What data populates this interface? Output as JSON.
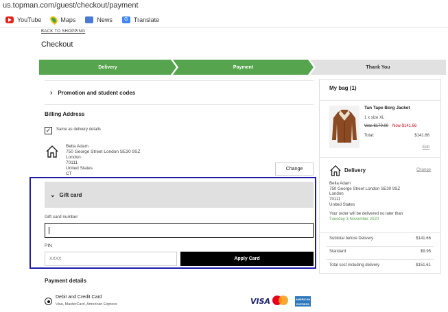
{
  "browser": {
    "url": "us.topman.com/guest/checkout/payment",
    "bookmarks": [
      {
        "label": "YouTube",
        "icon": "youtube-icon"
      },
      {
        "label": "Maps",
        "icon": "maps-icon"
      },
      {
        "label": "News",
        "icon": "news-icon"
      },
      {
        "label": "Translate",
        "icon": "translate-icon"
      }
    ]
  },
  "page": {
    "back_link": "BACK TO SHOPPING",
    "title": "Checkout"
  },
  "steps": [
    {
      "label": "Delivery",
      "state": "complete"
    },
    {
      "label": "Payment",
      "state": "current"
    },
    {
      "label": "Thank You",
      "state": "upcoming"
    }
  ],
  "promo": {
    "label": "Promotion and student codes"
  },
  "billing": {
    "heading": "Billing Address",
    "same_as_delivery_label": "Same as delivery details",
    "same_as_delivery_checked": true,
    "address_lines": [
      "Bella Adam",
      "750 George Street London SE30 9SZ",
      "London",
      "70111",
      "United States",
      "CT"
    ],
    "change_label": "Change"
  },
  "gift_card": {
    "heading": "Gift card",
    "number_label": "Gift card number",
    "number_value": "",
    "pin_label": "PIN",
    "pin_placeholder": "XXXX",
    "apply_label": "Apply Card"
  },
  "payment": {
    "heading": "Payment details",
    "method_label": "Debit and Credit Card",
    "method_sub": "Visa, MasterCard, American Express",
    "visa_text": "VISA",
    "amex_text": "AMERICAN EXPRESS"
  },
  "bag": {
    "title": "My bag (1)",
    "item": {
      "name": "Tan Tape Borg Jacket",
      "qty_size": "1 x size XL",
      "was_price": "Was $170.00",
      "now_price": "Now $141.66",
      "total_label": "Total:",
      "total_value": "$141.66",
      "edit_label": "Edit"
    },
    "delivery": {
      "title": "Delivery",
      "change_label": "Change",
      "address_lines": [
        "Bella Adam",
        "750 George Street London SE30 9SZ",
        "London",
        "70111",
        "United States"
      ],
      "note": "Your order will be delivered no later than",
      "date": "Tuesday 3 November 2020"
    },
    "summary": [
      {
        "label": "Subtotal before Delivery",
        "value": "$141.66"
      },
      {
        "label": "Standard",
        "value": "$9.95"
      },
      {
        "label": "Total cost including delivery",
        "value": "$151.61"
      }
    ]
  },
  "colors": {
    "step_active": "#56a44e",
    "step_inactive": "#e1e1e1",
    "highlight_border": "#1c1ca8",
    "sale_red": "#d0021b"
  }
}
